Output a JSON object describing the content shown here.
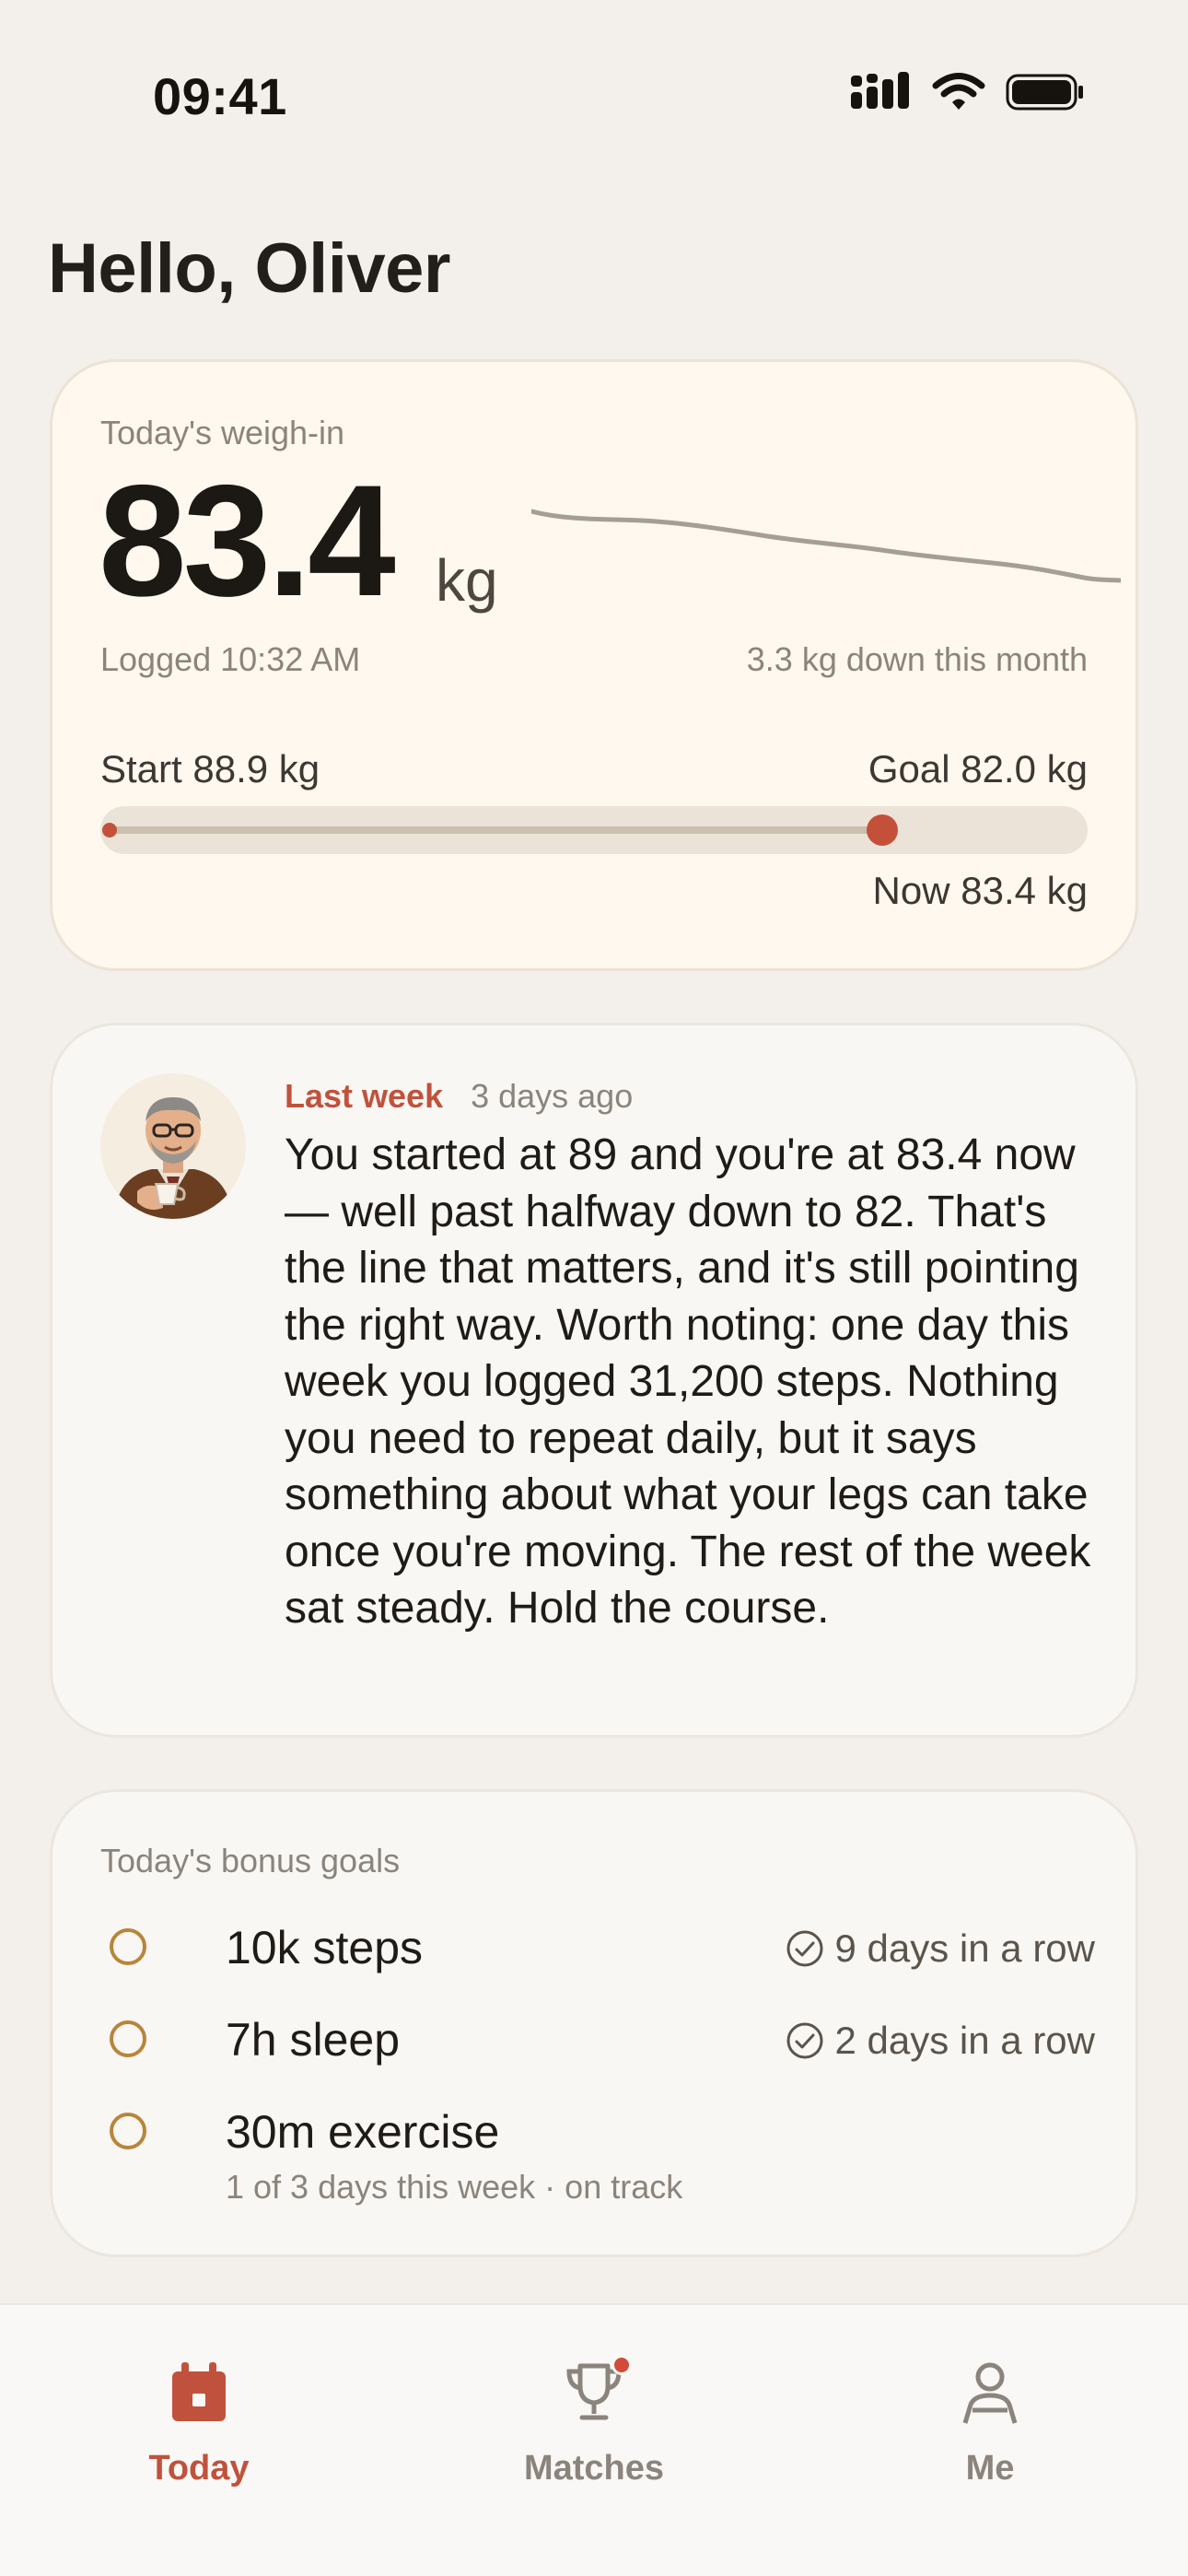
{
  "status_bar": {
    "time": "09:41"
  },
  "greeting": "Hello, Oliver",
  "weigh_in": {
    "label": "Today's weigh-in",
    "weight": "83.4",
    "unit": "kg",
    "logged": "Logged 10:32 AM",
    "trend_note": "3.3 kg down this month",
    "start_label": "Start 88.9 kg",
    "goal_label": "Goal 82.0 kg",
    "now_label": "Now 83.4 kg",
    "start_kg": 88.9,
    "goal_kg": 82.0,
    "now_kg": 83.4,
    "accent_color": "#c5503a"
  },
  "coach": {
    "avatar": "coach-avatar-illustration",
    "title": "Last week",
    "when": "3 days ago",
    "message": "You started at 89 and you're at 83.4 now — well past halfway down to 82. That's the line that matters, and it's still pointing the right way. Worth noting: one day this week you logged 31,200 steps. Nothing you need to repeat daily, but it says something about what your legs can take once you're moving. The rest of the week sat steady. Hold the course."
  },
  "bonus_goals": {
    "label": "Today's bonus goals",
    "items": [
      {
        "name": "10k steps",
        "streak": "9 days in a row",
        "icon": "check-circle-icon"
      },
      {
        "name": "7h sleep",
        "streak": "2 days in a row",
        "icon": "check-circle-icon"
      },
      {
        "name": "30m exercise",
        "sub": "1 of 3 days this week · on track"
      }
    ]
  },
  "tabbar": {
    "tabs": [
      {
        "label": "Today",
        "icon": "calendar-icon",
        "active": true
      },
      {
        "label": "Matches",
        "icon": "trophy-icon",
        "active": false,
        "badge": true
      },
      {
        "label": "Me",
        "icon": "person-icon",
        "active": false
      }
    ]
  }
}
